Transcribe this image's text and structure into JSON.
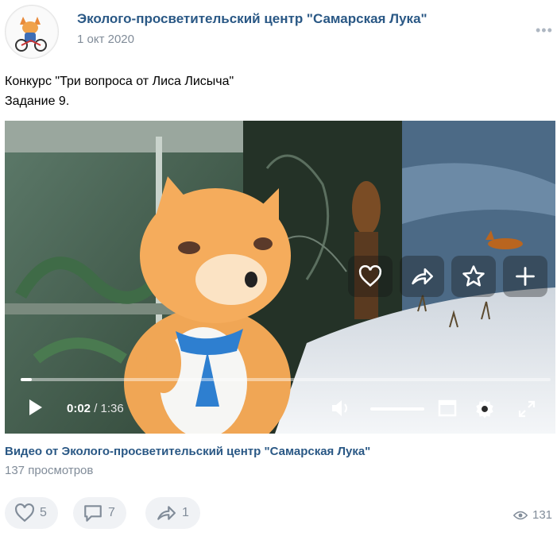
{
  "post": {
    "author": "Эколого-просветительский центр \"Самарская Лука\"",
    "date": "1 окт 2020",
    "text_line1": "Конкурс \"Три вопроса от Лиса Лисыча\"",
    "text_line2": "Задание 9."
  },
  "video": {
    "current_time": "0:02",
    "separator_and_duration": " / 1:36",
    "progress_fraction": 0.02,
    "volume_fraction": 1.0,
    "overlay_buttons": [
      "heart-icon",
      "share-icon",
      "star-icon",
      "plus-icon"
    ],
    "title": "Видео от Эколого-просветительский центр \"Самарская Лука\"",
    "views": "137 просмотров"
  },
  "reactions": {
    "likes": "5",
    "comments": "7",
    "shares": "1",
    "views": "131"
  },
  "colors": {
    "link": "#2a5885",
    "muted": "#818c99",
    "pill_bg": "#f0f2f5"
  }
}
